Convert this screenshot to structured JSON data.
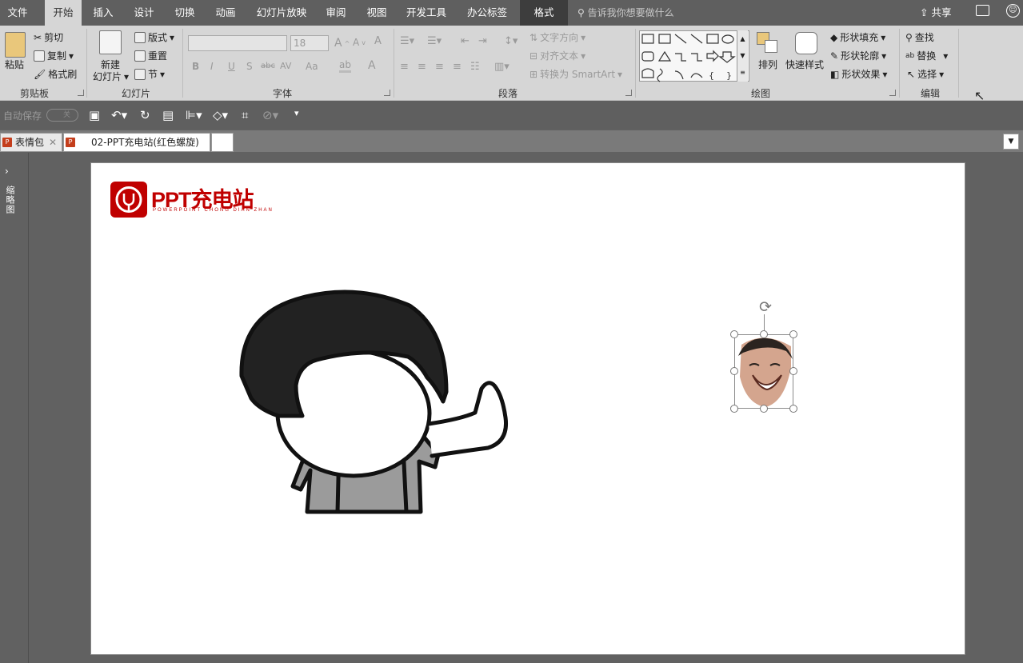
{
  "menu_tabs": [
    "文件",
    "开始",
    "插入",
    "设计",
    "切换",
    "动画",
    "幻灯片放映",
    "审阅",
    "视图",
    "开发工具",
    "办公标签",
    "格式"
  ],
  "search_placeholder": "告诉我你想要做什么",
  "share_label": "共享",
  "ribbon": {
    "clipboard": {
      "paste": "粘贴",
      "cut": "剪切",
      "copy": "复制",
      "format_painter": "格式刷",
      "label": "剪贴板"
    },
    "slides": {
      "new_slide_line1": "新建",
      "new_slide_line2": "幻灯片",
      "layout": "版式",
      "reset": "重置",
      "section": "节",
      "label": "幻灯片"
    },
    "font": {
      "size": "18",
      "bold": "B",
      "italic": "I",
      "underline": "U",
      "shadow": "S",
      "strike": "abc",
      "spacing": "AV",
      "case": "Aa",
      "label": "字体"
    },
    "paragraph": {
      "text_direction": "文字方向",
      "align_text": "对齐文本",
      "smartart": "转换为 SmartArt",
      "label": "段落"
    },
    "drawing": {
      "arrange": "排列",
      "quick_styles": "快速样式",
      "shape_fill": "形状填充",
      "shape_outline": "形状轮廓",
      "shape_effects": "形状效果",
      "label": "绘图"
    },
    "editing": {
      "find": "查找",
      "replace": "替换",
      "select": "选择",
      "label": "编辑"
    }
  },
  "qat": {
    "autosave_label": "自动保存",
    "autosave_state": "关"
  },
  "doc_tabs": [
    "表情包",
    "02-PPT充电站(红色螺旋)"
  ],
  "side_panel_label": "缩略图",
  "slide": {
    "logo_title": "PPT充电站",
    "logo_subtitle": "POWERPOINT CHONG DIAN ZHAN"
  },
  "colors": {
    "brand_red": "#c00000",
    "chrome": "#5f5f5f",
    "ribbon": "#d6d6d6"
  }
}
